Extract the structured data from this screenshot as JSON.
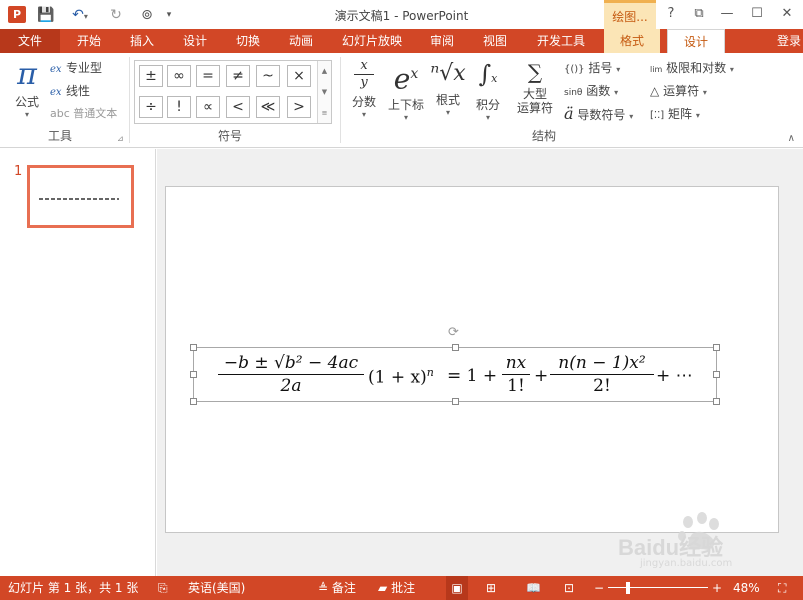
{
  "titlebar": {
    "app_icon_letter": "P",
    "document_title": "演示文稿1 - PowerPoint",
    "context_title": "绘图...",
    "help": "?",
    "restore_ribbon": "⧉",
    "minimize": "—",
    "maximize": "☐",
    "close": "✕"
  },
  "tabs": {
    "file": "文件",
    "items": [
      "开始",
      "插入",
      "设计",
      "切换",
      "动画",
      "幻灯片放映",
      "审阅",
      "视图",
      "开发工具"
    ],
    "context_format": "格式",
    "context_design": "设计",
    "login": "登录"
  },
  "ribbon": {
    "tools": {
      "formula_icon": "π",
      "formula_label": "公式",
      "professional": "专业型",
      "linear": "线性",
      "normal_text": "abc 普通文本",
      "group_label": "工具"
    },
    "symbols": {
      "items": [
        "±",
        "∞",
        "=",
        "≠",
        "~",
        "×",
        "÷",
        "!",
        "∝",
        "<",
        "≪",
        ">"
      ],
      "group_label": "符号"
    },
    "structures": {
      "fraction_label": "分数",
      "script_label": "上下标",
      "radical_label": "根式",
      "integral_label": "积分",
      "large_operator_label_1": "大型",
      "large_operator_label_2": "运算符",
      "bracket": "括号",
      "function": "函数",
      "accent": "导数符号",
      "limit_log": "极限和对数",
      "operator": "运算符",
      "matrix": "矩阵",
      "group_label": "结构"
    }
  },
  "slides_panel": {
    "slide_number": "1"
  },
  "equation": {
    "quad_num": "−b ± √b² − 4ac",
    "quad_den": "2a",
    "binom_base": "(1 + x)",
    "binom_exp": "n",
    "eq_rhs": "= 1 +",
    "f1_num": "nx",
    "f1_den": "1!",
    "plus": "+",
    "f2_num": "n(n − 1)x²",
    "f2_den": "2!",
    "tail": "+ ⋯"
  },
  "statusbar": {
    "slide_info": "幻灯片 第 1 张，共 1 张",
    "language": "英语(美国)",
    "notes": "备注",
    "comments": "批注",
    "zoom_minus": "−",
    "zoom_plus": "+",
    "zoom_level": "48%"
  },
  "watermark": {
    "text": "Baidu经验",
    "subtext": "jingyan.baidu.com"
  },
  "colors": {
    "brand": "#d24726",
    "context_tab": "#fbe5b6",
    "context_text": "#c55a11"
  }
}
